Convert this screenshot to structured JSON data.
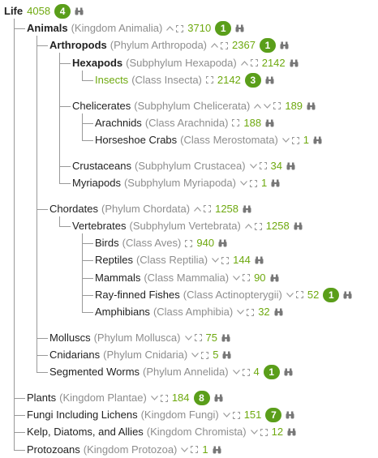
{
  "colors": {
    "count": "#6ea90f",
    "badge": "#5a9e1a",
    "scientific": "#8e8e8e",
    "line": "#999999"
  },
  "nodes": [
    {
      "name": "Life",
      "sci": "",
      "count": "4058",
      "badge": "4",
      "bold": true,
      "up": false,
      "down": false,
      "expand": false,
      "row": 0,
      "depth": 0
    },
    {
      "name": "Animals",
      "sci": "(Kingdom Animalia)",
      "count": "3710",
      "badge": "1",
      "bold": true,
      "up": true,
      "down": false,
      "expand": true,
      "row": 1,
      "depth": 1
    },
    {
      "name": "Arthropods",
      "sci": "(Phylum Arthropoda)",
      "count": "2367",
      "badge": "1",
      "bold": true,
      "up": true,
      "down": false,
      "expand": true,
      "row": 2,
      "depth": 2
    },
    {
      "name": "Hexapods",
      "sci": "(Subphylum Hexapoda)",
      "count": "2142",
      "badge": "",
      "bold": true,
      "up": true,
      "down": false,
      "expand": true,
      "row": 3,
      "depth": 3
    },
    {
      "name": "Insects",
      "sci": "(Class Insecta)",
      "count": "2142",
      "badge": "3",
      "bold": false,
      "green": true,
      "up": false,
      "down": false,
      "expand": true,
      "row": 4,
      "depth": 4
    },
    {
      "name": "Chelicerates",
      "sci": "(Subphylum Chelicerata)",
      "count": "189",
      "badge": "",
      "bold": false,
      "up": true,
      "down": true,
      "expand": true,
      "row": 5.5,
      "depth": 3
    },
    {
      "name": "Arachnids",
      "sci": "(Class Arachnida)",
      "count": "188",
      "badge": "",
      "bold": false,
      "up": false,
      "down": false,
      "expand": true,
      "row": 6.5,
      "depth": 4
    },
    {
      "name": "Horseshoe Crabs",
      "sci": "(Class Merostomata)",
      "count": "1",
      "badge": "",
      "bold": false,
      "up": false,
      "down": true,
      "expand": true,
      "row": 7.5,
      "depth": 4
    },
    {
      "name": "Crustaceans",
      "sci": "(Subphylum Crustacea)",
      "count": "34",
      "badge": "",
      "bold": false,
      "up": false,
      "down": true,
      "expand": true,
      "row": 9,
      "depth": 3
    },
    {
      "name": "Myriapods",
      "sci": "(Subphylum Myriapoda)",
      "count": "1",
      "badge": "",
      "bold": false,
      "up": false,
      "down": true,
      "expand": true,
      "row": 10,
      "depth": 3
    },
    {
      "name": "Chordates",
      "sci": "(Phylum Chordata)",
      "count": "1258",
      "badge": "",
      "bold": false,
      "up": true,
      "down": false,
      "expand": true,
      "row": 11.5,
      "depth": 2
    },
    {
      "name": "Vertebrates",
      "sci": "(Subphylum Vertebrata)",
      "count": "1258",
      "badge": "",
      "bold": false,
      "up": true,
      "down": false,
      "expand": true,
      "row": 12.5,
      "depth": 3
    },
    {
      "name": "Birds",
      "sci": "(Class Aves)",
      "count": "940",
      "badge": "",
      "bold": false,
      "up": false,
      "down": false,
      "expand": true,
      "row": 13.5,
      "depth": 4
    },
    {
      "name": "Reptiles",
      "sci": "(Class Reptilia)",
      "count": "144",
      "badge": "",
      "bold": false,
      "up": false,
      "down": true,
      "expand": true,
      "row": 14.5,
      "depth": 4
    },
    {
      "name": "Mammals",
      "sci": "(Class Mammalia)",
      "count": "90",
      "badge": "",
      "bold": false,
      "up": false,
      "down": true,
      "expand": true,
      "row": 15.5,
      "depth": 4
    },
    {
      "name": "Ray-finned Fishes",
      "sci": "(Class Actinopterygii)",
      "count": "52",
      "badge": "1",
      "bold": false,
      "up": false,
      "down": true,
      "expand": true,
      "row": 16.5,
      "depth": 4
    },
    {
      "name": "Amphibians",
      "sci": "(Class Amphibia)",
      "count": "32",
      "badge": "",
      "bold": false,
      "up": false,
      "down": true,
      "expand": true,
      "row": 17.5,
      "depth": 4
    },
    {
      "name": "Molluscs",
      "sci": "(Phylum Mollusca)",
      "count": "75",
      "badge": "",
      "bold": false,
      "up": false,
      "down": true,
      "expand": true,
      "row": 19,
      "depth": 2
    },
    {
      "name": "Cnidarians",
      "sci": "(Phylum Cnidaria)",
      "count": "5",
      "badge": "",
      "bold": false,
      "up": false,
      "down": true,
      "expand": true,
      "row": 20,
      "depth": 2
    },
    {
      "name": "Segmented Worms",
      "sci": "(Phylum Annelida)",
      "count": "4",
      "badge": "1",
      "bold": false,
      "up": false,
      "down": true,
      "expand": true,
      "row": 21,
      "depth": 2
    },
    {
      "name": "Plants",
      "sci": "(Kingdom Plantae)",
      "count": "184",
      "badge": "8",
      "bold": false,
      "up": false,
      "down": true,
      "expand": true,
      "row": 22.5,
      "depth": 1
    },
    {
      "name": "Fungi Including Lichens",
      "sci": "(Kingdom Fungi)",
      "count": "151",
      "badge": "7",
      "bold": false,
      "up": false,
      "down": true,
      "expand": true,
      "row": 23.5,
      "depth": 1
    },
    {
      "name": "Kelp, Diatoms, and Allies",
      "sci": "(Kingdom Chromista)",
      "count": "12",
      "badge": "",
      "bold": false,
      "up": false,
      "down": true,
      "expand": true,
      "row": 24.5,
      "depth": 1
    },
    {
      "name": "Protozoans",
      "sci": "(Kingdom Protozoa)",
      "count": "1",
      "badge": "",
      "bold": false,
      "up": false,
      "down": true,
      "expand": true,
      "row": 25.5,
      "depth": 1
    }
  ]
}
